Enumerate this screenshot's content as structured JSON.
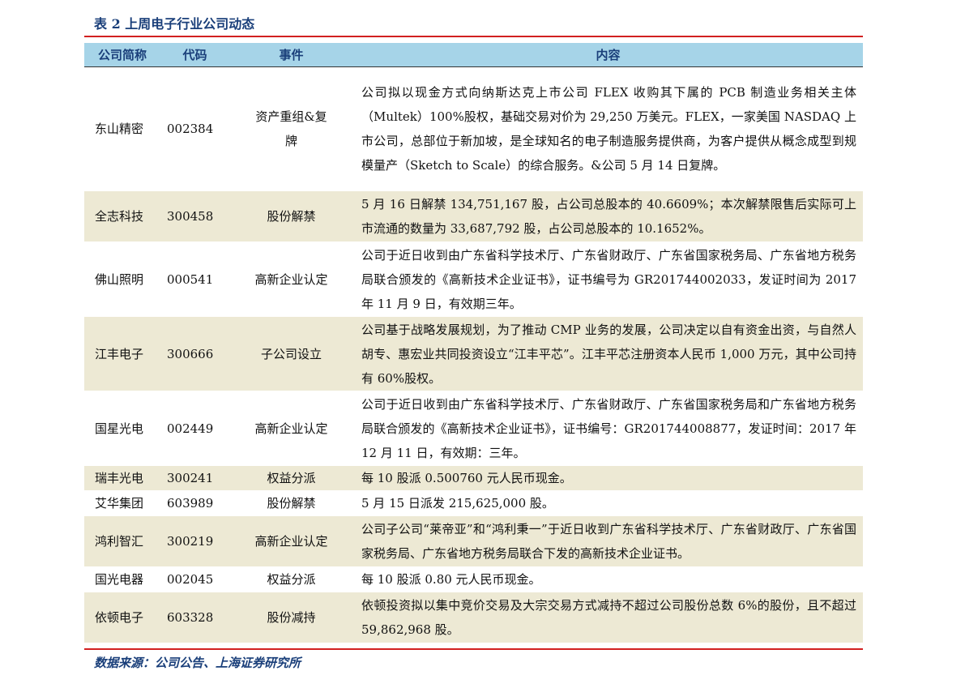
{
  "title": "表 2 上周电子行业公司动态",
  "headers": {
    "name": "公司简称",
    "code": "代码",
    "event": "事件",
    "content": "内容"
  },
  "rows": [
    {
      "name": "东山精密",
      "code": "002384",
      "event": "资产重组&复牌",
      "content": "公司拟以现金方式向纳斯达克上市公司 FLEX 收购其下属的 PCB 制造业务相关主体（Multek）100%股权，基础交易对价为 29,250 万美元。FLEX，一家美国 NASDAQ 上市公司，总部位于新加坡，是全球知名的电子制造服务提供商，为客户提供从概念成型到规模量产（Sketch to Scale）的综合服务。&公司 5 月 14 日复牌。"
    },
    {
      "name": "全志科技",
      "code": "300458",
      "event": "股份解禁",
      "content": "5 月 16 日解禁 134,751,167 股，占公司总股本的 40.6609%；本次解禁限售后实际可上市流通的数量为 33,687,792 股，占公司总股本的 10.1652%。"
    },
    {
      "name": "佛山照明",
      "code": "000541",
      "event": "高新企业认定",
      "content": "公司于近日收到由广东省科学技术厅、广东省财政厅、广东省国家税务局、广东省地方税务局联合颁发的《高新技术企业证书》，证书编号为 GR201744002033，发证时间为 2017 年 11 月 9 日，有效期三年。"
    },
    {
      "name": "江丰电子",
      "code": "300666",
      "event": "子公司设立",
      "content": "公司基于战略发展规划，为了推动 CMP 业务的发展，公司决定以自有资金出资，与自然人胡专、惠宏业共同投资设立“江丰平芯”。江丰平芯注册资本人民币 1,000 万元，其中公司持有 60%股权。"
    },
    {
      "name": "国星光电",
      "code": "002449",
      "event": "高新企业认定",
      "content": "公司于近日收到由广东省科学技术厅、广东省财政厅、广东省国家税务局和广东省地方税务局联合颁发的《高新技术企业证书》，证书编号：GR201744008877，发证时间：2017 年 12 月 11 日，有效期：三年。"
    },
    {
      "name": "瑞丰光电",
      "code": "300241",
      "event": "权益分派",
      "content": "每 10 股派 0.500760 元人民币现金。"
    },
    {
      "name": "艾华集团",
      "code": "603989",
      "event": "股份解禁",
      "content": "5 月 15 日派发 215,625,000 股。"
    },
    {
      "name": "鸿利智汇",
      "code": "300219",
      "event": "高新企业认定",
      "content": "公司子公司“莱帝亚”和“鸿利秉一”于近日收到广东省科学技术厅、广东省财政厅、广东省国家税务局、广东省地方税务局联合下发的高新技术企业证书。"
    },
    {
      "name": "国光电器",
      "code": "002045",
      "event": "权益分派",
      "content": "每 10 股派 0.80 元人民币现金。"
    },
    {
      "name": "依顿电子",
      "code": "603328",
      "event": "股份减持",
      "content": "依顿投资拟以集中竞价交易及大宗交易方式减持不超过公司股份总数 6%的股份，且不超过 59,862,968 股。"
    }
  ],
  "source": "数据来源：公司公告、上海证券研究所"
}
